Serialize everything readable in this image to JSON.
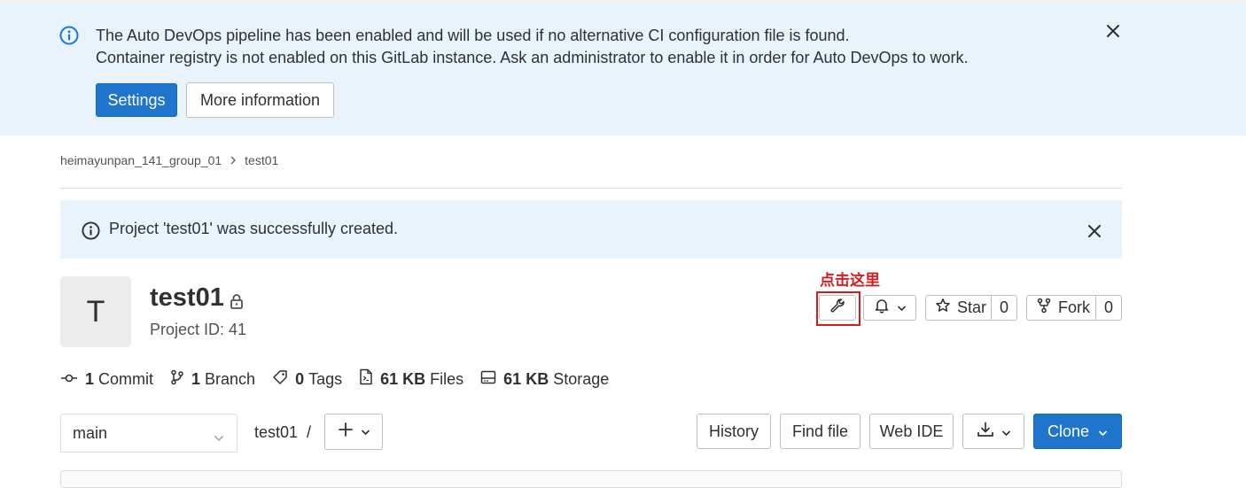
{
  "devops_banner": {
    "line1": "The Auto DevOps pipeline has been enabled and will be used if no alternative CI configuration file is found.",
    "line2": "Container registry is not enabled on this GitLab instance. Ask an administrator to enable it in order for Auto DevOps to work.",
    "settings_label": "Settings",
    "more_info_label": "More information"
  },
  "breadcrumb": {
    "group": "heimayunpan_141_group_01",
    "project": "test01"
  },
  "alert": {
    "message": "Project 'test01' was successfully created."
  },
  "project": {
    "avatar_letter": "T",
    "name": "test01",
    "id_text": "Project ID: 41"
  },
  "annotation": {
    "text": "点击这里"
  },
  "actions": {
    "star_label": "Star",
    "star_count": "0",
    "fork_label": "Fork",
    "fork_count": "0"
  },
  "stats": {
    "commits_count": "1",
    "commits_label": "Commit",
    "branches_count": "1",
    "branches_label": "Branch",
    "tags_count": "0",
    "tags_label": "Tags",
    "files_size": "61 KB",
    "files_label": "Files",
    "storage_size": "61 KB",
    "storage_label": "Storage"
  },
  "repo_toolbar": {
    "branch": "main",
    "path_project": "test01",
    "path_sep": "/",
    "history_label": "History",
    "find_file_label": "Find file",
    "web_ide_label": "Web IDE",
    "clone_label": "Clone"
  },
  "colors": {
    "primary": "#1f75cb",
    "info_bg": "#e8f3fb",
    "annotation": "#d21f1f"
  },
  "icons": [
    "info-icon",
    "close-icon",
    "chevron-right-icon",
    "lock-icon",
    "wrench-icon",
    "bell-icon",
    "chevron-down-icon",
    "star-icon",
    "fork-icon",
    "commit-icon",
    "branch-icon",
    "tag-icon",
    "file-icon",
    "storage-icon",
    "plus-icon",
    "download-icon"
  ]
}
